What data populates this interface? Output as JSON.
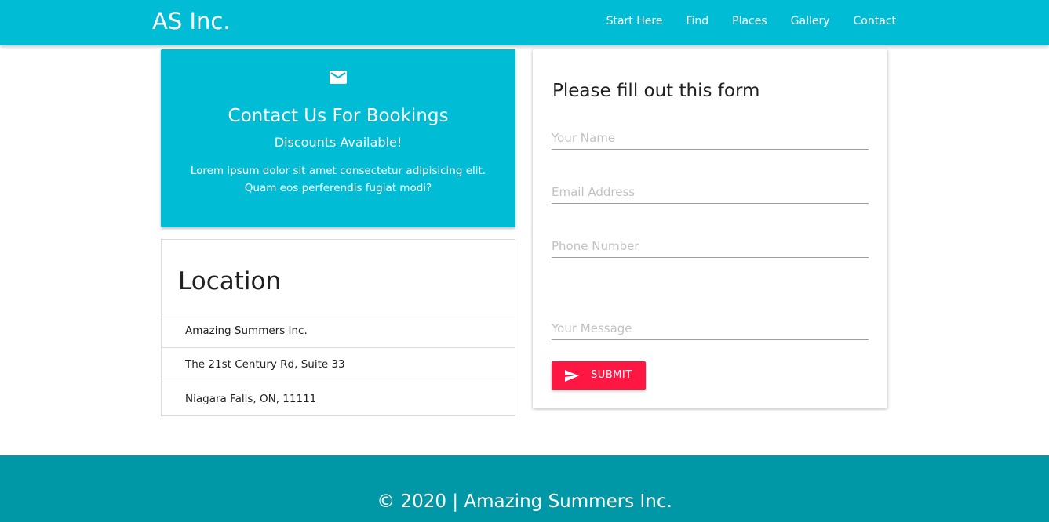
{
  "navbar": {
    "brand": "AS Inc.",
    "links": [
      "Start Here",
      "Find",
      "Places",
      "Gallery",
      "Contact"
    ],
    "color": "#00bcd4"
  },
  "contact_card": {
    "icon": "mail-icon",
    "title": "Contact Us For Bookings",
    "subtitle": "Discounts Available!",
    "body": "Lorem ipsum dolor sit amet consectetur adipisicing elit. Quam eos perferendis fugiat modi?"
  },
  "location": {
    "title": "Location",
    "items": [
      "Amazing Summers Inc.",
      "The 21st Century Rd, Suite 33",
      "Niagara Falls, ON, 11111"
    ]
  },
  "form": {
    "title": "Please fill out this form",
    "name_placeholder": "Your Name",
    "email_placeholder": "Email Address",
    "phone_placeholder": "Phone Number",
    "message_placeholder": "Your Message",
    "submit_label": "SUBMIT",
    "submit_icon": "send-icon",
    "submit_color": "#ff1744"
  },
  "footer": {
    "text": "© 2020 | Amazing Summers Inc.",
    "color": "#0097a7"
  }
}
